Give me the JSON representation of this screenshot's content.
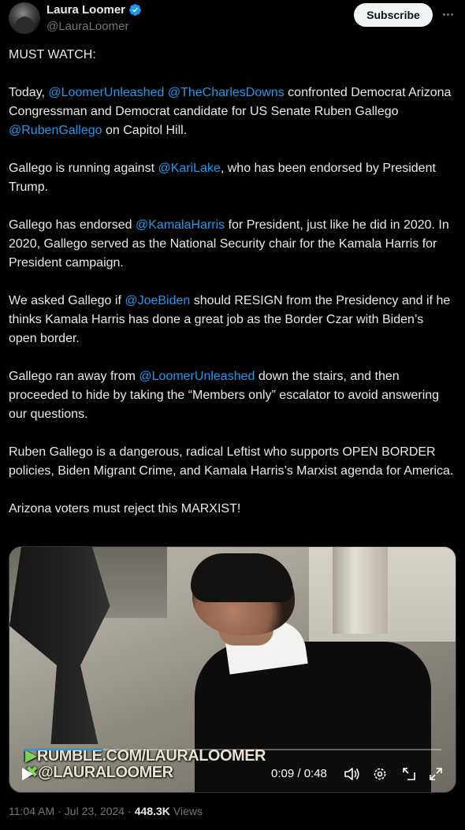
{
  "author": {
    "display_name": "Laura Loomer",
    "handle": "@LauraLoomer"
  },
  "actions": {
    "subscribe_label": "Subscribe"
  },
  "tweet": {
    "paragraphs": [
      [
        {
          "t": "MUST WATCH:"
        }
      ],
      [
        {
          "t": "Today, "
        },
        {
          "m": "@LoomerUnleashed"
        },
        {
          "t": " "
        },
        {
          "m": "@TheCharlesDowns"
        },
        {
          "t": " confronted Democrat Arizona Congressman and Democrat candidate for US Senate Ruben Gallego "
        },
        {
          "m": "@RubenGallego"
        },
        {
          "t": " on Capitol Hill."
        }
      ],
      [
        {
          "t": "Gallego is running against "
        },
        {
          "m": "@KariLake"
        },
        {
          "t": ", who has been endorsed by President Trump."
        }
      ],
      [
        {
          "t": "Gallego has endorsed "
        },
        {
          "m": "@KamalaHarris"
        },
        {
          "t": " for President, just like he did in 2020. In 2020, Gallego served as the National Security chair for the Kamala Harris for President campaign."
        }
      ],
      [
        {
          "t": "We asked Gallego if "
        },
        {
          "m": "@JoeBiden"
        },
        {
          "t": " should RESIGN from the Presidency and if he thinks Kamala Harris has done a great job as the Border Czar with Biden’s open border."
        }
      ],
      [
        {
          "t": "Gallego ran away from "
        },
        {
          "m": "@LoomerUnleashed"
        },
        {
          "t": " down the stairs, and then proceeded to hide by taking the “Members only” escalator to avoid answering our questions."
        }
      ],
      [
        {
          "t": "Ruben Gallego is a dangerous, radical Leftist who supports OPEN BORDER policies, Biden Migrant Crime, and Kamala Harris’s Marxist agenda for America."
        }
      ],
      [
        {
          "t": "Arizona voters must reject this MARXIST!"
        }
      ]
    ]
  },
  "video": {
    "watermark_line1": "RUMBLE.COM/LAURALOOMER",
    "watermark_line2": "@LAURALOOMER",
    "time_display": "0:09 / 0:48",
    "progress_fraction": 0.19,
    "controls": [
      "play-icon",
      "volume-icon",
      "settings-icon",
      "pip-icon",
      "fullscreen-icon"
    ]
  },
  "meta": {
    "time": "11:04 AM",
    "sep1": "·",
    "date": "Jul 23, 2024",
    "sep2": "·",
    "views_count": "448.3K",
    "views_label": "Views"
  },
  "colors": {
    "link": "#1d9bf0",
    "secondary_text": "#71767b",
    "primary_text": "#e7e9ea",
    "background": "#000000"
  }
}
